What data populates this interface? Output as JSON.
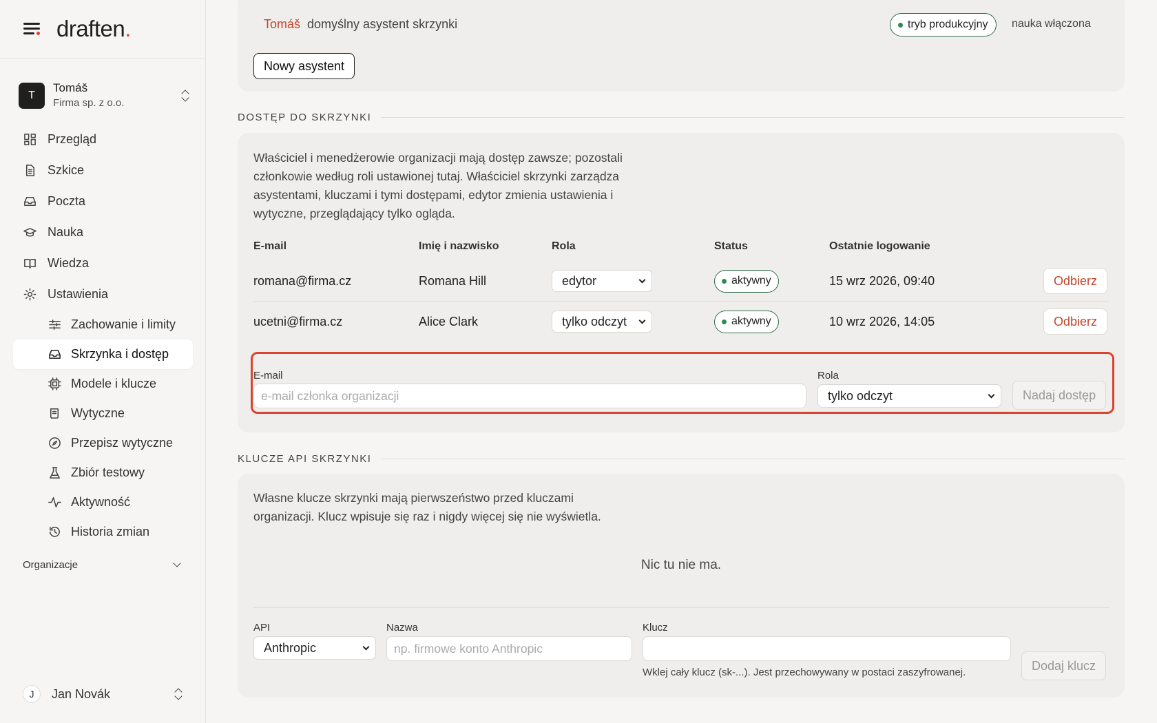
{
  "brand": {
    "name": "draften",
    "period": "."
  },
  "workspace": {
    "initial": "T",
    "name": "Tomáš",
    "org": "Firma sp. z o.o."
  },
  "nav": {
    "overview": "Przegląd",
    "drafts": "Szkice",
    "mail": "Poczta",
    "learning": "Nauka",
    "knowledge": "Wiedza",
    "settings": "Ustawienia",
    "sub": {
      "behavior": "Zachowanie i limity",
      "mailbox": "Skrzynka i dostęp",
      "models": "Modele i klucze",
      "guidelines": "Wytyczne",
      "rewrite": "Przepisz wytyczne",
      "testset": "Zbiór testowy",
      "activity": "Aktywność",
      "history": "Historia zmian"
    },
    "organizations": "Organizacje"
  },
  "user": {
    "initial": "J",
    "name": "Jan Novák"
  },
  "assistant": {
    "name": "Tomáš",
    "description": "domyślny asystent skrzynki",
    "mode": "tryb produkcyjny",
    "learning": "nauka włączona",
    "new_button": "Nowy asystent"
  },
  "access": {
    "title": "DOSTĘP DO SKRZYNKI",
    "description": [
      "Właściciel i menedżerowie organizacji mają dostęp zawsze; pozostali",
      "członkowie według roli ustawionej tutaj. Właściciel skrzynki zarządza",
      "asystentami, kluczami i tymi dostępami, edytor zmienia ustawienia i",
      "wytyczne, przeglądający tylko ogląda."
    ],
    "columns": {
      "email": "E-mail",
      "name": "Imię i nazwisko",
      "role": "Rola",
      "status": "Status",
      "last_login": "Ostatnie logowanie"
    },
    "rows": [
      {
        "email": "romana@firma.cz",
        "name": "Romana Hill",
        "role": "edytor",
        "status": "aktywny",
        "last_login": "15 wrz 2026, 09:40",
        "revoke": "Odbierz"
      },
      {
        "email": "ucetni@firma.cz",
        "name": "Alice Clark",
        "role": "tylko odczyt",
        "status": "aktywny",
        "last_login": "10 wrz 2026, 14:05",
        "revoke": "Odbierz"
      }
    ],
    "grant": {
      "email_label": "E-mail",
      "email_placeholder": "e-mail członka organizacji",
      "role_label": "Rola",
      "role_value": "tylko odczyt",
      "button": "Nadaj dostęp"
    }
  },
  "keys": {
    "title": "KLUCZE API SKRZYNKI",
    "description": [
      "Własne klucze skrzynki mają pierwszeństwo przed kluczami",
      "organizacji. Klucz wpisuje się raz i nigdy więcej się nie wyświetla."
    ],
    "empty": "Nic tu nie ma.",
    "api_label": "API",
    "api_value": "Anthropic",
    "name_label": "Nazwa",
    "name_placeholder": "np. firmowe konto Anthropic",
    "key_label": "Klucz",
    "key_value": "",
    "hint": "Wklej cały klucz (sk-...). Jest przechowywany w postaci zaszyfrowanej.",
    "add_button": "Dodaj klucz"
  },
  "colors": {
    "accent": "#d9432f",
    "status_green": "#2f8a55",
    "revoke_red": "#c2462c"
  }
}
